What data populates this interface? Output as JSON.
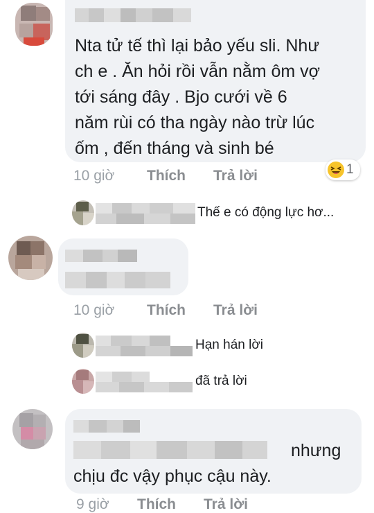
{
  "comments": [
    {
      "text_lines": [
        "Nta tử tế thì lại bảo yếu sli. Như",
        "ch e . Ăn hỏi rồi vẫn nằm ôm vợ",
        "tới sáng đây . Bjo cưới về 6",
        "năm rùi có tha ngày nào trừ lúc",
        "ốm , đến tháng và sinh bé"
      ],
      "time": "10 giờ",
      "like": "Thích",
      "reply": "Trả lời",
      "reaction_count": "1",
      "reaction_icon": "haha-emoji-icon"
    },
    {
      "time": "10 giờ",
      "like": "Thích",
      "reply": "Trả lời"
    },
    {
      "text_lines": [
        "nhưng",
        "chịu đc vậy phục cậu này."
      ],
      "time": "9 giờ",
      "like": "Thích",
      "reply": "Trả lời"
    }
  ],
  "replies": [
    {
      "preview": "Thế e có động lực hơ..."
    },
    {
      "preview": "Hạn hán lời"
    },
    {
      "preview": "đã trả lời"
    }
  ],
  "colors": {
    "bubble": "#f0f2f5",
    "meta": "#8a8d91",
    "text": "#1c1e21"
  }
}
